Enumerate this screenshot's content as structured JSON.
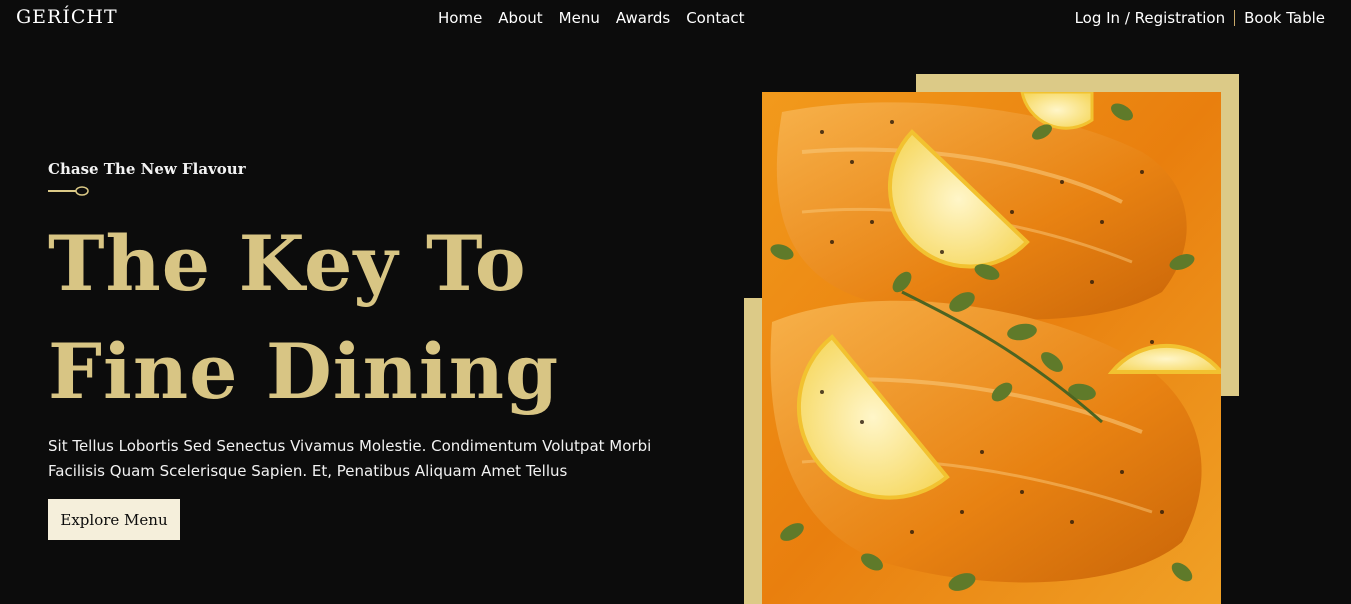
{
  "brand": {
    "logo": "GERÍCHT"
  },
  "nav": {
    "links": [
      "Home",
      "About",
      "Menu",
      "Awards",
      "Contact"
    ],
    "login_label": "Log In / Registration",
    "book_label": "Book Table"
  },
  "hero": {
    "tagline": "Chase The New Flavour",
    "title_line1": "The Key To",
    "title_line2": "Fine Dining",
    "description_line1": "Sit Tellus Lobortis Sed Senectus Vivamus Molestie. Condimentum Volutpat Morbi",
    "description_line2": "Facilisis Quam Scelerisque Sapien. Et, Penatibus Aliquam Amet Tellus",
    "cta_label": "Explore Menu"
  },
  "colors": {
    "background": "#0c0c0c",
    "gold": "#dcca87",
    "title_gold": "#d8c584",
    "button_bg": "#f5efdb"
  },
  "icons": {
    "divider": "spoon-icon"
  }
}
